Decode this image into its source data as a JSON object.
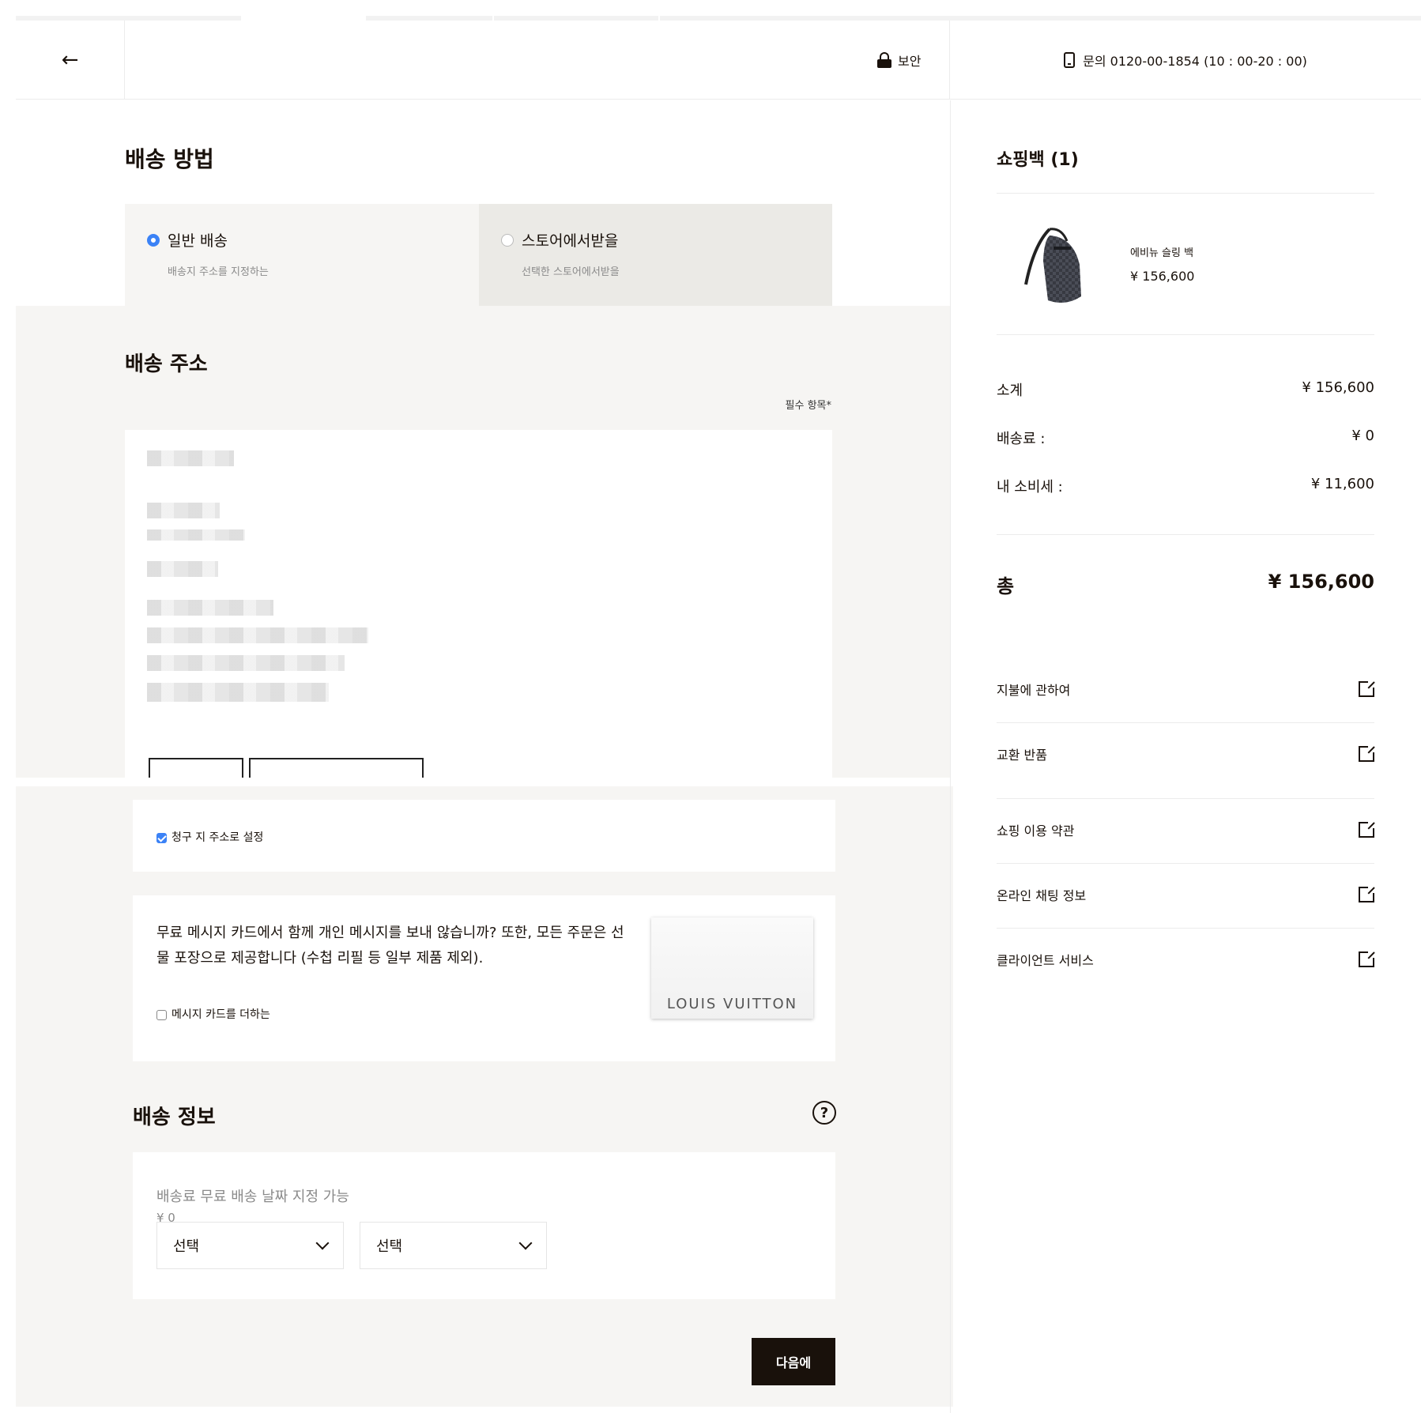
{
  "header": {
    "back_icon": "←",
    "secure_label": "보안",
    "contact": "문의 0120-00-1854 (10 : 00-20 : 00)"
  },
  "delivery_method": {
    "title": "배송 방법",
    "options": [
      {
        "label": "일반 배송",
        "sub": "배송지 주소를 지정하는",
        "selected": true
      },
      {
        "label": "스토어에서받을",
        "sub": "선택한 스토어에서받을",
        "selected": false
      }
    ]
  },
  "address": {
    "title": "배송 주소",
    "required_note": "필수 항목*"
  },
  "billing": {
    "label": "청구 지 주소로 설정",
    "checked": true
  },
  "message_card": {
    "text": "무료 메시지 카드에서 함께 개인 메시지를 보내 않습니까? 또한, 모든 주문은 선물 포장으로 제공합니다 (수첩 리필 등 일부 제품 제외).",
    "checkbox_label": "메시지 카드를 더하는",
    "card_brand": "LOUIS VUITTON"
  },
  "shipping_info": {
    "title": "배송 정보",
    "help_icon": "?",
    "option_label": "배송료 무료 배송 날짜 지정 가능",
    "option_price": "¥ 0",
    "select_1": "선택",
    "select_2": "선택"
  },
  "next_button": "다음에",
  "cart": {
    "title": "쇼핑백 (1)",
    "product_name": "에비뉴 슬링 백",
    "product_price": "¥ 156,600",
    "subtotal_label": "소계",
    "subtotal_value": "¥ 156,600",
    "shipping_label": "배송료 :",
    "shipping_value": "¥ 0",
    "tax_label": "내 소비세 :",
    "tax_value": "¥ 11,600",
    "total_label": "총",
    "total_value": "¥ 156,600",
    "links": [
      "지불에 관하여",
      "교환 반품",
      "쇼핑 이용 약관",
      "온라인 채팅 정보",
      "클라이언트 서비스"
    ]
  },
  "colors": {
    "accent": "#3b82f6",
    "primary_dark": "#19110b",
    "panel_gray": "#f6f5f3"
  }
}
